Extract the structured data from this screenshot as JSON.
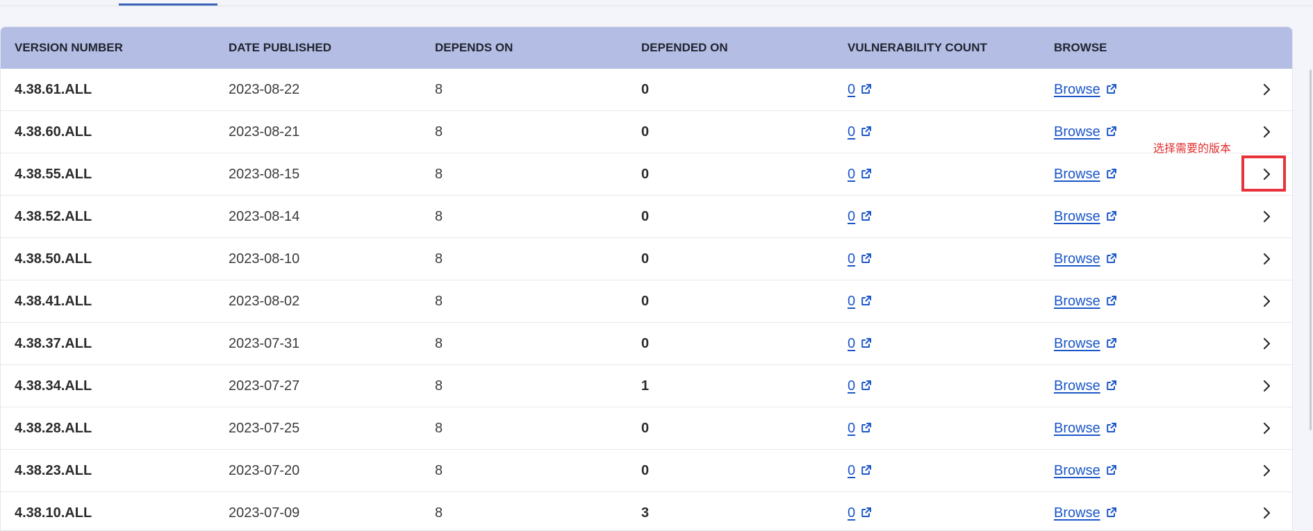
{
  "headers": {
    "version": "VERSION NUMBER",
    "date": "DATE PUBLISHED",
    "depends_on": "DEPENDS ON",
    "depended_on": "DEPENDED ON",
    "vuln": "VULNERABILITY COUNT",
    "browse": "BROWSE"
  },
  "rows": [
    {
      "version": "4.38.61.ALL",
      "date": "2023-08-22",
      "depends_on": "8",
      "depended_on": "0",
      "vuln": "0",
      "browse": "Browse"
    },
    {
      "version": "4.38.60.ALL",
      "date": "2023-08-21",
      "depends_on": "8",
      "depended_on": "0",
      "vuln": "0",
      "browse": "Browse"
    },
    {
      "version": "4.38.55.ALL",
      "date": "2023-08-15",
      "depends_on": "8",
      "depended_on": "0",
      "vuln": "0",
      "browse": "Browse"
    },
    {
      "version": "4.38.52.ALL",
      "date": "2023-08-14",
      "depends_on": "8",
      "depended_on": "0",
      "vuln": "0",
      "browse": "Browse"
    },
    {
      "version": "4.38.50.ALL",
      "date": "2023-08-10",
      "depends_on": "8",
      "depended_on": "0",
      "vuln": "0",
      "browse": "Browse"
    },
    {
      "version": "4.38.41.ALL",
      "date": "2023-08-02",
      "depends_on": "8",
      "depended_on": "0",
      "vuln": "0",
      "browse": "Browse"
    },
    {
      "version": "4.38.37.ALL",
      "date": "2023-07-31",
      "depends_on": "8",
      "depended_on": "0",
      "vuln": "0",
      "browse": "Browse"
    },
    {
      "version": "4.38.34.ALL",
      "date": "2023-07-27",
      "depends_on": "8",
      "depended_on": "1",
      "vuln": "0",
      "browse": "Browse"
    },
    {
      "version": "4.38.28.ALL",
      "date": "2023-07-25",
      "depends_on": "8",
      "depended_on": "0",
      "vuln": "0",
      "browse": "Browse"
    },
    {
      "version": "4.38.23.ALL",
      "date": "2023-07-20",
      "depends_on": "8",
      "depended_on": "0",
      "vuln": "0",
      "browse": "Browse"
    },
    {
      "version": "4.38.10.ALL",
      "date": "2023-07-09",
      "depends_on": "8",
      "depended_on": "3",
      "vuln": "0",
      "browse": "Browse"
    }
  ],
  "annotation": {
    "text": "选择需要的版本",
    "color": "#e03030"
  },
  "colors": {
    "header_bg": "#b4bde3",
    "link": "#1a56c8",
    "highlight": "#e8323a",
    "tab_indicator": "#3a62b8"
  },
  "icons": {
    "external": "external-link-icon",
    "row_action": "chevron-right-icon"
  }
}
